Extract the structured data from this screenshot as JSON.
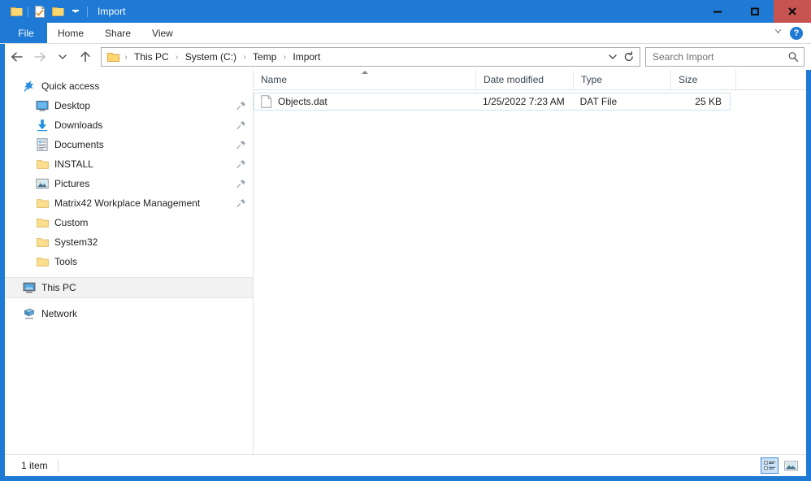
{
  "window": {
    "title": "Import",
    "accent_color": "#1e7ad4",
    "close_color": "#c75450"
  },
  "quick_access_toolbar": {
    "items": [
      {
        "name": "folder-icon",
        "label": "Explorer"
      },
      {
        "name": "properties-icon",
        "label": "Properties"
      },
      {
        "name": "new-folder-icon",
        "label": "New folder"
      }
    ],
    "customize_label": "Customize Quick Access Toolbar"
  },
  "window_controls": {
    "minimize": "Minimize",
    "maximize": "Maximize",
    "close": "Close"
  },
  "ribbon": {
    "tabs": [
      {
        "label": "File",
        "active": true
      },
      {
        "label": "Home",
        "active": false
      },
      {
        "label": "Share",
        "active": false
      },
      {
        "label": "View",
        "active": false
      }
    ],
    "expand_label": "Expand the Ribbon",
    "help_label": "?"
  },
  "address_bar": {
    "back_label": "Back",
    "forward_label": "Forward",
    "recent_label": "Recent locations",
    "up_label": "Up",
    "breadcrumbs": [
      "This PC",
      "System (C:)",
      "Temp",
      "Import"
    ],
    "separator": "›",
    "dropdown_label": "Previous locations",
    "refresh_label": "Refresh"
  },
  "search": {
    "placeholder": "Search Import",
    "value": ""
  },
  "navigation_pane": {
    "groups": [
      {
        "header": {
          "label": "Quick access",
          "icon": "star-pin-icon"
        },
        "items": [
          {
            "label": "Desktop",
            "icon": "desktop-icon",
            "pinned": true
          },
          {
            "label": "Downloads",
            "icon": "downloads-icon",
            "pinned": true
          },
          {
            "label": "Documents",
            "icon": "documents-icon",
            "pinned": true
          },
          {
            "label": "INSTALL",
            "icon": "folder-icon",
            "pinned": true
          },
          {
            "label": "Pictures",
            "icon": "pictures-icon",
            "pinned": true
          },
          {
            "label": "Matrix42 Workplace Management",
            "icon": "folder-icon",
            "pinned": true
          },
          {
            "label": "Custom",
            "icon": "folder-icon",
            "pinned": false
          },
          {
            "label": "System32",
            "icon": "folder-icon",
            "pinned": false
          },
          {
            "label": "Tools",
            "icon": "folder-icon",
            "pinned": false
          }
        ]
      }
    ],
    "roots": [
      {
        "label": "This PC",
        "icon": "this-pc-icon",
        "selected": true
      },
      {
        "label": "Network",
        "icon": "network-icon",
        "selected": false
      }
    ]
  },
  "file_list": {
    "columns": [
      {
        "label": "Name",
        "sorted": true,
        "sort_direction": "ascending"
      },
      {
        "label": "Date modified",
        "sorted": false
      },
      {
        "label": "Type",
        "sorted": false
      },
      {
        "label": "Size",
        "sorted": false
      }
    ],
    "rows": [
      {
        "name": "Objects.dat",
        "date_modified": "1/25/2022 7:23 AM",
        "type": "DAT File",
        "size": "25 KB",
        "icon": "dat-file-icon"
      }
    ]
  },
  "status_bar": {
    "item_count": "1 item",
    "details_view_label": "Details view",
    "large_icons_view_label": "Large icons view",
    "active_view": "details"
  }
}
